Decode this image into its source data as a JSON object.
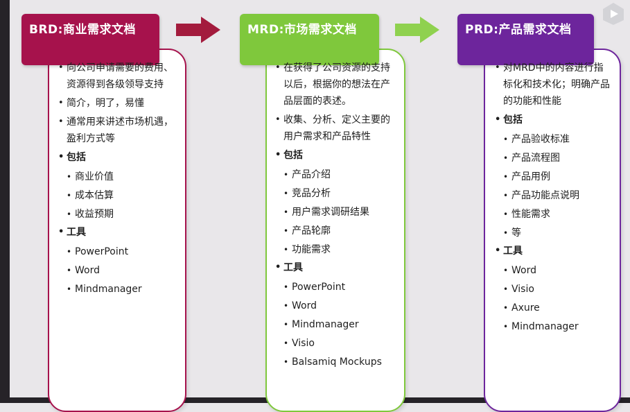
{
  "colors": {
    "brd": "#a6124c",
    "mrd": "#7fc83c",
    "prd": "#6d259c",
    "arrow_red": "#a31b3d",
    "arrow_green": "#8fd14f"
  },
  "brd": {
    "title": "BRD:商业需求文档",
    "bullets": [
      "向公司申请需要的费用、资源得到各级领导支持",
      "简介，明了，易懂",
      "通常用来讲述市场机遇，盈利方式等"
    ],
    "includes_label": "包括",
    "includes": [
      "商业价值",
      "成本估算",
      "收益预期"
    ],
    "tools_label": "工具",
    "tools": [
      "PowerPoint",
      "Word",
      "Mindmanager"
    ]
  },
  "mrd": {
    "title": "MRD:市场需求文档",
    "bullets": [
      "在获得了公司资源的支持以后，根据你的想法在产品层面的表述。",
      "收集、分析、定义主要的用户需求和产品特性"
    ],
    "includes_label": "包括",
    "includes": [
      "产品介绍",
      "竞品分析",
      "用户需求调研结果",
      "产品轮廓",
      "功能需求"
    ],
    "tools_label": "工具",
    "tools": [
      "PowerPoint",
      "Word",
      "Mindmanager",
      "Visio",
      "Balsamiq Mockups"
    ]
  },
  "prd": {
    "title": "PRD:产品需求文档",
    "bullets": [
      "对MRD中的内容进行指标化和技术化；明确产品的功能和性能"
    ],
    "includes_label": "包括",
    "includes": [
      "产品验收标准",
      "产品流程图",
      "产品用例",
      "产品功能点说明",
      "性能需求",
      "等"
    ],
    "tools_label": "工具",
    "tools": [
      "Word",
      "Visio",
      "Axure",
      "Mindmanager"
    ]
  }
}
